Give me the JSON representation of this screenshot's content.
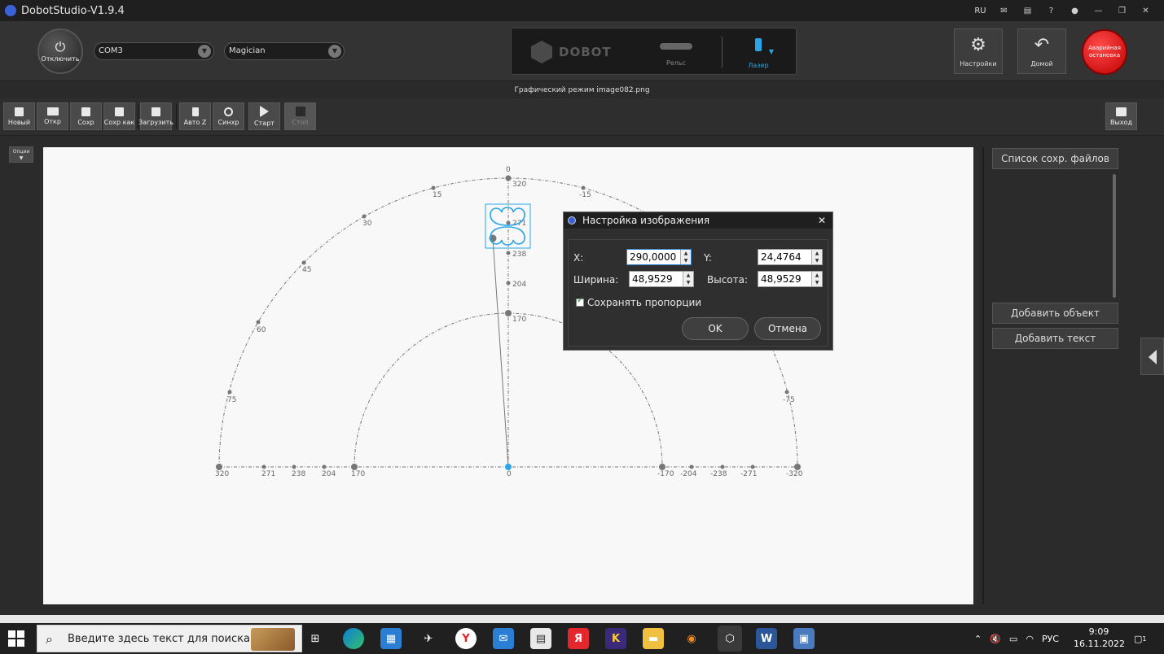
{
  "window": {
    "title": "DobotStudio-V1.9.4",
    "lang": "RU"
  },
  "header": {
    "disconnect_label": "Отключить",
    "port": "COM3",
    "device": "Magician",
    "brand": "DOBOT",
    "rail_label": "Рельс",
    "laser_label": "Лазер",
    "settings_label": "Настройки",
    "home_label": "Домой",
    "estop_label": "Аварийная остановка"
  },
  "subtitle": "Графический режим   image082.png",
  "toolbar": {
    "new": "Новый",
    "open": "Откр",
    "save": "Сохр",
    "save_as": "Сохр как",
    "load": "Загрузить",
    "auto_z": "Авто Z",
    "sync": "Синхр",
    "start": "Старт",
    "stop": "Стоп",
    "exit": "Выход"
  },
  "options_label": "Опции",
  "canvas": {
    "top_label": "0",
    "arc_labels": [
      "15",
      "30",
      "45",
      "60",
      "75",
      "-15",
      "-75"
    ],
    "axis_labels": [
      "320",
      "271",
      "238",
      "204",
      "170",
      "0",
      "-170",
      "-204",
      "-238",
      "-271",
      "-320"
    ],
    "vertical_labels": [
      "320",
      "271",
      "238",
      "204",
      "170"
    ]
  },
  "right_panel": {
    "saved_files": "Список сохр. файлов",
    "add_object": "Добавить объект",
    "add_text": "Добавить текст"
  },
  "dialog": {
    "title": "Настройка изображения",
    "x_label": "X:",
    "x_value": "290,0000",
    "y_label": "Y:",
    "y_value": "24,4764",
    "width_label": "Ширина:",
    "width_value": "48,9529",
    "height_label": "Высота:",
    "height_value": "48,9529",
    "keep_ratio": "Сохранять пропорции",
    "ok": "OK",
    "cancel": "Отмена"
  },
  "taskbar": {
    "search_placeholder": "Введите здесь текст для поиска",
    "lang": "РУС",
    "time": "9:09",
    "date": "16.11.2022",
    "notification_count": "1"
  }
}
